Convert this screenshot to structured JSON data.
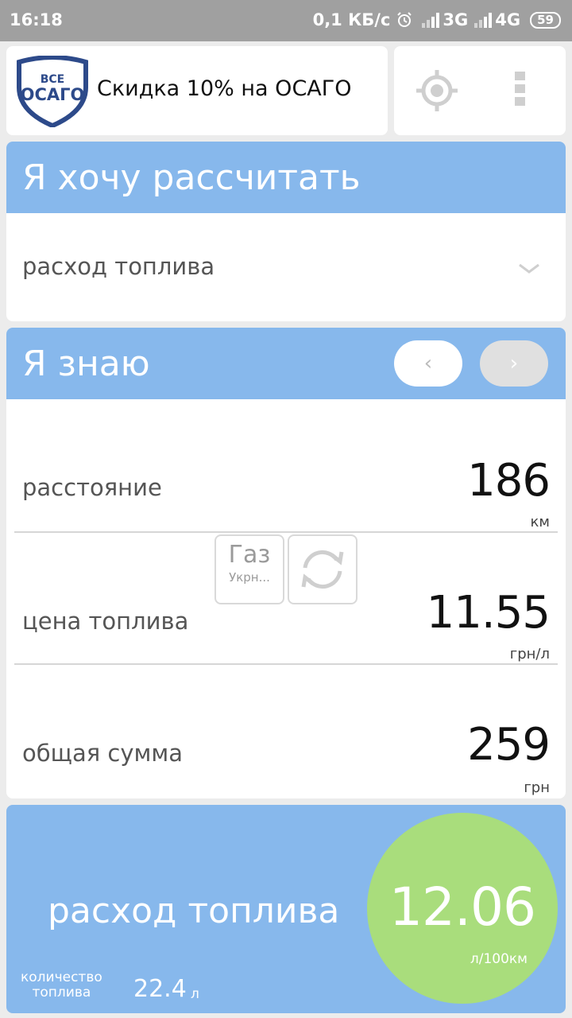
{
  "status_bar": {
    "time": "16:18",
    "network_speed": "0,1 КБ/с",
    "sim1_type": "3G",
    "sim2_type": "4G",
    "battery": "59"
  },
  "promo": {
    "logo_line1": "ВСЕ",
    "logo_line2": "ОСАГО",
    "text": "Скидка 10% на ОСАГО"
  },
  "want_section": {
    "title": "Я хочу рассчитать",
    "selected_option": "расход топлива"
  },
  "know_section": {
    "title": "Я знаю",
    "prev_label": "‹",
    "next_label": "›",
    "fields": [
      {
        "label": "расстояние",
        "value": "186",
        "unit": "км"
      },
      {
        "label": "цена топлива",
        "value": "11.55",
        "unit": "грн/л"
      },
      {
        "label": "общая сумма",
        "value": "259",
        "unit": "грн"
      }
    ],
    "fuel_chip": {
      "title": "Газ",
      "subtitle": "Укрн..."
    }
  },
  "result": {
    "label": "расход топлива",
    "value": "12.06",
    "unit": "л/100км",
    "quantity_label_line1": "количество",
    "quantity_label_line2": "топлива",
    "quantity_value": "22.4",
    "quantity_unit": "л"
  },
  "colors": {
    "header_blue": "#87b8ec",
    "result_green": "#a9dd7c",
    "status_bar": "#a0a0a0"
  }
}
